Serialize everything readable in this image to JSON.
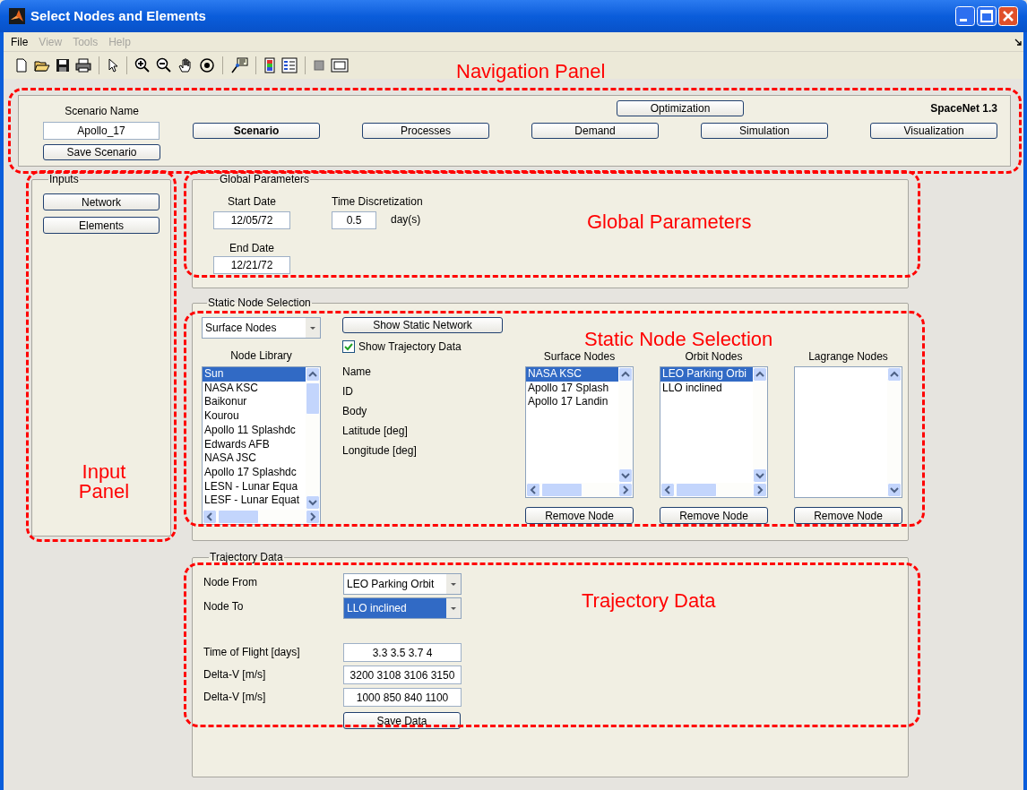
{
  "window": {
    "title": "Select Nodes and Elements"
  },
  "menu": [
    {
      "label": "File",
      "disabled": false
    },
    {
      "label": "View",
      "disabled": true
    },
    {
      "label": "Tools",
      "disabled": true
    },
    {
      "label": "Help",
      "disabled": true
    }
  ],
  "navigation": {
    "scenario_label": "Scenario Name",
    "scenario_name": "Apollo_17",
    "save_button": "Save Scenario",
    "optimization_button": "Optimization",
    "version": "SpaceNet 1.3",
    "tabs": [
      {
        "label": "Scenario",
        "selected": true
      },
      {
        "label": "Processes",
        "selected": false
      },
      {
        "label": "Demand",
        "selected": false
      },
      {
        "label": "Simulation",
        "selected": false
      },
      {
        "label": "Visualization",
        "selected": false
      }
    ],
    "annotation": {
      "label": "Navigation Panel"
    }
  },
  "inputs": {
    "title": "Inputs",
    "buttons": [
      "Network",
      "Elements"
    ],
    "annotation": {
      "label": "Input Panel"
    }
  },
  "global_parameters": {
    "title": "Global Parameters",
    "start_date_label": "Start Date",
    "start_date": "12/05/72",
    "end_date_label": "End Date",
    "end_date": "12/21/72",
    "time_label": "Time Discretization",
    "time_value": "0.5",
    "time_unit": "day(s)",
    "annotation": {
      "label": "Global Parameters"
    }
  },
  "static_node_selection": {
    "title": "Static Node Selection",
    "node_type": "Surface Nodes",
    "show_network_button": "Show Static Network",
    "show_trajectory": {
      "label": "Show Trajectory Data",
      "checked": true
    },
    "library": {
      "title": "Node Library",
      "items": [
        {
          "label": "Sun",
          "selected": true
        },
        {
          "label": "NASA KSC",
          "selected": false
        },
        {
          "label": "Baikonur",
          "selected": false
        },
        {
          "label": "Kourou",
          "selected": false
        },
        {
          "label": "Apollo 11 Splashdc",
          "selected": false
        },
        {
          "label": "Edwards AFB",
          "selected": false
        },
        {
          "label": "NASA JSC",
          "selected": false
        },
        {
          "label": "Apollo 17 Splashdc",
          "selected": false
        },
        {
          "label": "LESN - Lunar Equa",
          "selected": false
        },
        {
          "label": "LESF - Lunar Equat",
          "selected": false
        }
      ]
    },
    "property_labels": [
      "Name",
      "ID",
      "Body",
      "Latitude [deg]",
      "Longitude [deg]"
    ],
    "lists": [
      {
        "title": "Surface Nodes",
        "button": "Remove Node",
        "items": [
          {
            "label": "NASA KSC",
            "selected": true
          },
          {
            "label": "Apollo 17 Splash",
            "selected": false
          },
          {
            "label": "Apollo 17 Landin",
            "selected": false
          }
        ]
      },
      {
        "title": "Orbit Nodes",
        "button": "Remove Node",
        "items": [
          {
            "label": "LEO Parking Orbi",
            "selected": true
          },
          {
            "label": "LLO inclined",
            "selected": false
          }
        ]
      },
      {
        "title": "Lagrange Nodes",
        "button": "Remove Node"
      }
    ],
    "annotation": {
      "label": "Static Node Selection"
    }
  },
  "trajectory": {
    "title": "Trajectory Data",
    "fields": [
      {
        "kind": "dropdown",
        "label": "Node From",
        "value": "LEO Parking Orbit",
        "focused": false
      },
      {
        "kind": "dropdown",
        "label": "Node To",
        "value": "LLO inclined",
        "focused": true
      },
      {
        "kind": "text",
        "label": "Time of Flight [days]",
        "value": "3.3 3.5 3.7 4"
      },
      {
        "kind": "text",
        "label": "Delta-V [m/s]",
        "value": "3200 3108 3106 3150"
      },
      {
        "kind": "text",
        "label": "Delta-V [m/s]",
        "value": "1000 850 840 1100"
      }
    ],
    "save_button": "Save Data",
    "annotation": {
      "label": "Trajectory Data"
    }
  }
}
